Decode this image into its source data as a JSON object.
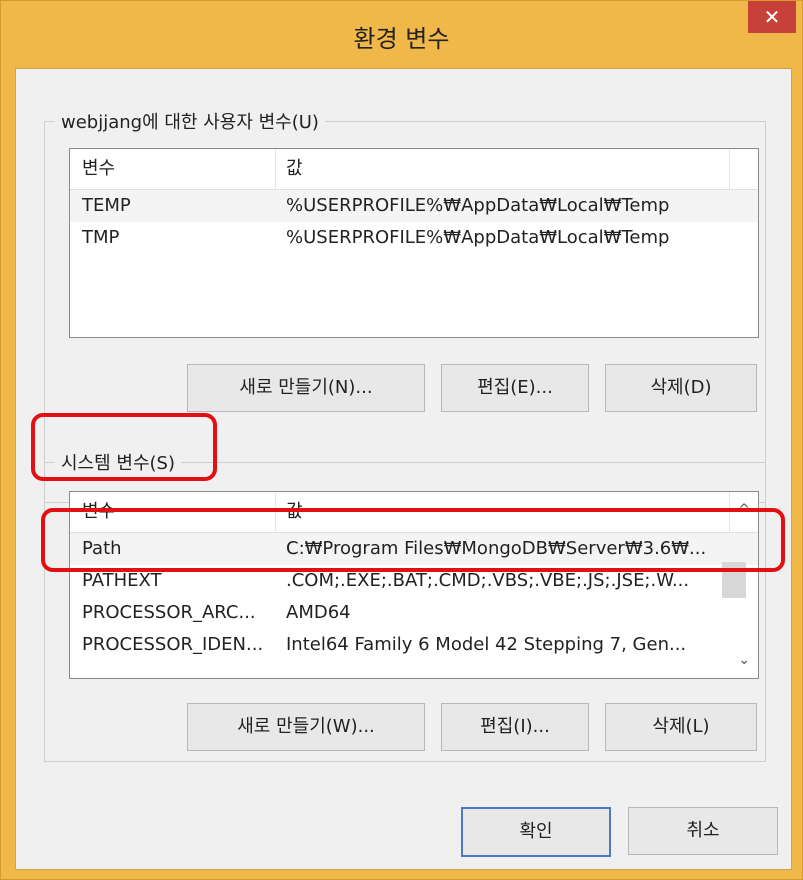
{
  "window": {
    "title": "환경 변수",
    "close_label": "✕"
  },
  "user_group": {
    "label": "webjjang에 대한 사용자 변수(U)",
    "columns": [
      "변수",
      "값"
    ],
    "rows": [
      [
        "TEMP",
        "%USERPROFILE%₩AppData₩Local₩Temp"
      ],
      [
        "TMP",
        "%USERPROFILE%₩AppData₩Local₩Temp"
      ]
    ],
    "buttons": {
      "new": "새로 만들기(N)...",
      "edit": "편집(E)...",
      "delete": "삭제(D)"
    }
  },
  "system_group": {
    "label": "시스템 변수(S)",
    "columns": [
      "변수",
      "값"
    ],
    "rows": [
      [
        "Path",
        "C:₩Program Files₩MongoDB₩Server₩3.6₩..."
      ],
      [
        "PATHEXT",
        ".COM;.EXE;.BAT;.CMD;.VBS;.VBE;.JS;.JSE;.W..."
      ],
      [
        "PROCESSOR_ARC...",
        "AMD64"
      ],
      [
        "PROCESSOR_IDEN...",
        "Intel64 Family 6 Model 42 Stepping 7, Gen..."
      ]
    ],
    "buttons": {
      "new": "새로 만들기(W)...",
      "edit": "편집(I)...",
      "delete": "삭제(L)"
    }
  },
  "footer": {
    "ok": "확인",
    "cancel": "취소"
  },
  "icons": {
    "scroll_up": "^",
    "scroll_down": "⌄"
  },
  "colors": {
    "highlight": "#e30f12",
    "title_bar": "#f0b849",
    "close": "#c7413a"
  }
}
